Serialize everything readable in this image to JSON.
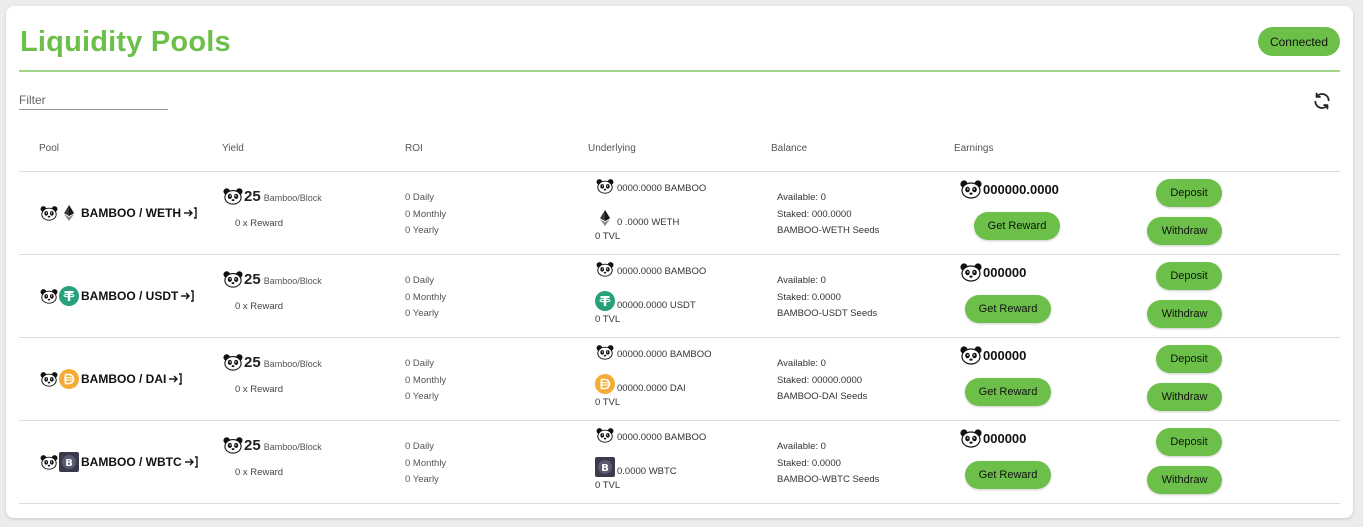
{
  "header": {
    "title": "Liquidity Pools",
    "connected_label": "Connected"
  },
  "filter": {
    "placeholder": "Filter"
  },
  "columns": [
    "Pool",
    "Yield",
    "ROI",
    "Underlying",
    "Balance",
    "Earnings"
  ],
  "rows": [
    {
      "pool": "BAMBOO / WETH",
      "token": "weth",
      "yield_value": "25",
      "yield_unit": "Bamboo/Block",
      "reward_multiplier": "0 x Reward",
      "roi_daily": "0 Daily",
      "roi_monthly": "0 Monthly",
      "roi_yearly": "0 Yearly",
      "underlying_bamboo": "0000.0000 BAMBOO",
      "underlying_token": "0 .0000 WETH",
      "tvl": "0 TVL",
      "available": "Available: 0",
      "staked": "Staked: 000.0000",
      "seeds": "BAMBOO-WETH Seeds",
      "earnings": "000000.0000",
      "get_reward_label": "Get Reward",
      "deposit_label": "Deposit",
      "withdraw_label": "Withdraw"
    },
    {
      "pool": "BAMBOO / USDT",
      "token": "usdt",
      "yield_value": "25",
      "yield_unit": "Bamboo/Block",
      "reward_multiplier": "0 x Reward",
      "roi_daily": "0 Daily",
      "roi_monthly": "0 Monthly",
      "roi_yearly": "0 Yearly",
      "underlying_bamboo": "0000.0000 BAMBOO",
      "underlying_token": "00000.0000 USDT",
      "tvl": "0 TVL",
      "available": "Available: 0",
      "staked": "Staked: 0.0000",
      "seeds": "BAMBOO-USDT Seeds",
      "earnings": "000000",
      "get_reward_label": "Get Reward",
      "deposit_label": "Deposit",
      "withdraw_label": "Withdraw"
    },
    {
      "pool": "BAMBOO / DAI",
      "token": "dai",
      "yield_value": "25",
      "yield_unit": "Bamboo/Block",
      "reward_multiplier": "0 x Reward",
      "roi_daily": "0 Daily",
      "roi_monthly": "0 Monthly",
      "roi_yearly": "0 Yearly",
      "underlying_bamboo": "00000.0000 BAMBOO",
      "underlying_token": "00000.0000 DAI",
      "tvl": "0 TVL",
      "available": "Available: 0",
      "staked": "Staked: 00000.0000",
      "seeds": "BAMBOO-DAI Seeds",
      "earnings": "000000",
      "get_reward_label": "Get Reward",
      "deposit_label": "Deposit",
      "withdraw_label": "Withdraw"
    },
    {
      "pool": "BAMBOO / WBTC",
      "token": "wbtc",
      "yield_value": "25",
      "yield_unit": "Bamboo/Block",
      "reward_multiplier": "0 x Reward",
      "roi_daily": "0 Daily",
      "roi_monthly": "0 Monthly",
      "roi_yearly": "0 Yearly",
      "underlying_bamboo": "0000.0000 BAMBOO",
      "underlying_token": "0.0000 WBTC",
      "tvl": "0 TVL",
      "available": "Available: 0",
      "staked": "Staked: 0.0000",
      "seeds": "BAMBOO-WBTC Seeds",
      "earnings": "000000",
      "get_reward_label": "Get Reward",
      "deposit_label": "Deposit",
      "withdraw_label": "Withdraw"
    }
  ],
  "colors": {
    "accent": "#6cc04a",
    "usdt": "#26a17b",
    "dai": "#f5ac37",
    "wbtc": "#3a3a4a",
    "weth": "#3c3c3d"
  }
}
